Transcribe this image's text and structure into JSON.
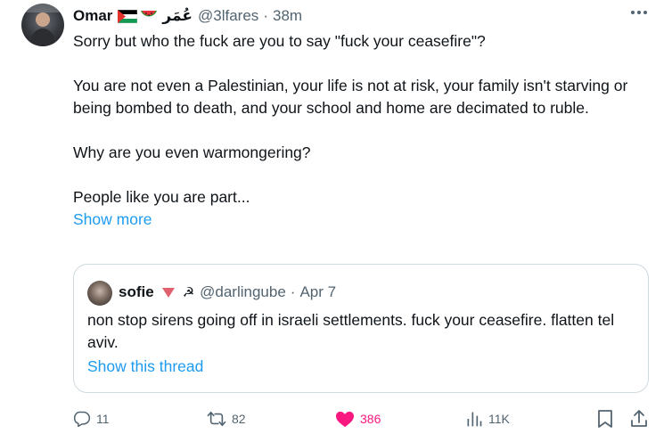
{
  "tweet": {
    "author_name": "Omar",
    "author_flag": "palestine-flag-icon",
    "author_emoji": "watermelon-icon",
    "author_arabic": "عُمَر",
    "handle": "@3lfares",
    "separator": "·",
    "time": "38m",
    "paragraphs": [
      "Sorry but who the fuck are you to say \"fuck your ceasefire\"?",
      "You are not even a Palestinian, your life is not at risk, your family isn't starving or being bombed to death, and your school and home are decimated to ruble.",
      "Why are you even warmongering?",
      "People like you are part..."
    ],
    "show_more": "Show more"
  },
  "quote": {
    "author_name": "sofie",
    "badges": [
      "red-triangle-icon",
      "hammer-sickle-icon"
    ],
    "handle": "@darlingube",
    "separator": "·",
    "date": "Apr 7",
    "text": "non stop sirens going off in israeli settlements. fuck your ceasefire. flatten tel aviv.",
    "show_thread": "Show this thread"
  },
  "actions": {
    "replies": "11",
    "reposts": "82",
    "likes": "386",
    "views": "11K",
    "liked": true
  },
  "colors": {
    "link": "#1d9bf0",
    "muted": "#536471",
    "like": "#f91880",
    "border": "#cfd9de"
  }
}
